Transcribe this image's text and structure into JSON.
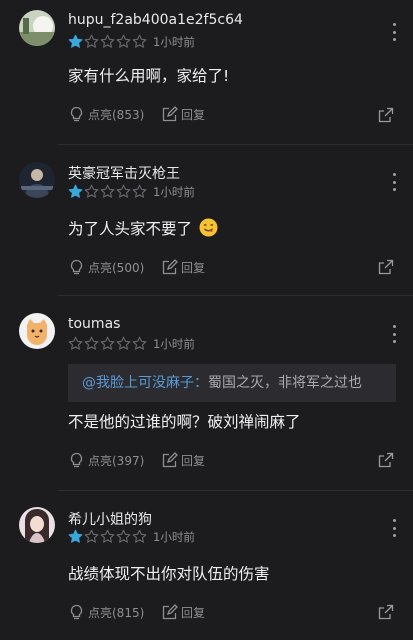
{
  "comments": [
    {
      "username": "hupu_f2ab400a1e2f5c64",
      "rating": 1,
      "time": "1小时前",
      "content": "家有什么用啊，家给了!",
      "likes": "点亮(853)",
      "reply": "回复"
    },
    {
      "username": "英豪冠军击灭枪王",
      "rating": 1,
      "time": "1小时前",
      "content": "为了人头家不要了",
      "emoji": "yum-face-emoji",
      "likes": "点亮(500)",
      "reply": "回复"
    },
    {
      "username": "toumas",
      "rating": 0,
      "time": "1小时前",
      "quote_user": "@我脸上可没麻子：",
      "quote_text": "蜀国之灭，非将军之过也",
      "content": "不是他的过谁的啊？破刘禅闹麻了",
      "likes": "点亮(397)",
      "reply": "回复"
    },
    {
      "username": "希儿小姐的狗",
      "rating": 1,
      "time": "1小时前",
      "content": "战绩体现不出你对队伍的伤害",
      "likes": "点亮(815)",
      "reply": "回复"
    }
  ],
  "colors": {
    "background": "#1c1c1e",
    "star_filled": "#3aa6d9",
    "star_empty": "#6a6a70",
    "quote_user": "#5a9bd5"
  },
  "icons": [
    "avatar",
    "star-icon",
    "more-icon",
    "lightbulb-icon",
    "edit-icon",
    "share-icon"
  ]
}
